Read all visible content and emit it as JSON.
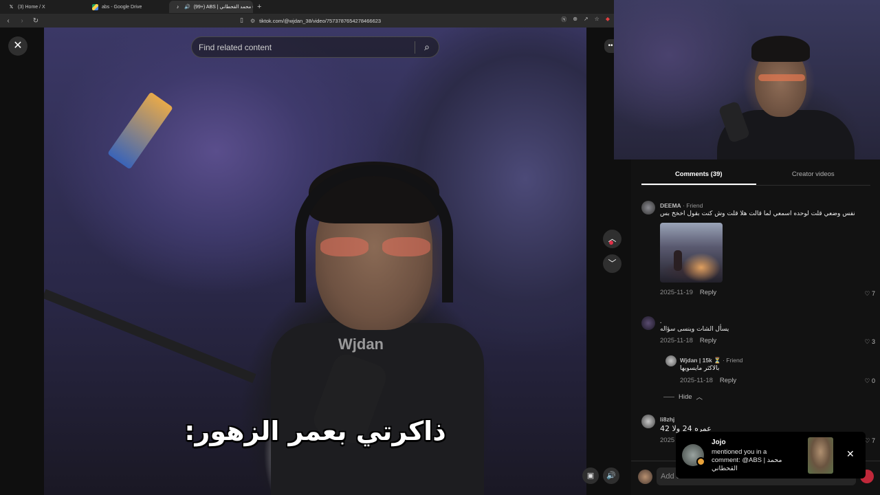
{
  "browser": {
    "tabs": [
      {
        "label": "(3) Home / X",
        "favicon": "x-logo-icon"
      },
      {
        "label": "abs - Google Drive",
        "favicon": "google-drive-icon"
      },
      {
        "label": "(99+) ABS | محمد القحطاني (@...",
        "favicon": "tiktok-icon"
      }
    ],
    "url": "tiktok.com/@wjdan_38/video/7573787654278466623"
  },
  "player": {
    "search_placeholder": "Find related content",
    "watermark": "Wjdan",
    "caption": "ذاكرتي بعمر الزهور:"
  },
  "panel": {
    "tab_comments": "Comments (39)",
    "tab_creator": "Creator videos",
    "comments": [
      {
        "name": "DEEMA",
        "tag": "· Friend",
        "text": "نفس وضعي قلت لوحده اسمعي لما قالت هلا قلت وش كنت بقول اخخخ بس",
        "date": "2025-11-19",
        "reply": "Reply",
        "likes": "7"
      },
      {
        "name": ".",
        "tag": "",
        "text": "يسأل الشات وينسى سؤاله",
        "date": "2025-11-18",
        "reply": "Reply",
        "likes": "3"
      },
      {
        "name": "Wjdan | 15k ⏳",
        "tag": "· Friend",
        "text": "بالاكثر مايسويها",
        "date": "2025-11-18",
        "reply": "Reply",
        "likes": "0"
      },
      {
        "name": "li8zhj",
        "tag": "",
        "text": "عمره 24 ولا 42",
        "date": "2025",
        "reply": "",
        "likes": "7"
      }
    ],
    "hide_label": "Hide",
    "add_placeholder": "Add comment..."
  },
  "toast": {
    "name": "Jojo",
    "text": "mentioned you in a comment: @ABS | محمد القحطاني"
  }
}
